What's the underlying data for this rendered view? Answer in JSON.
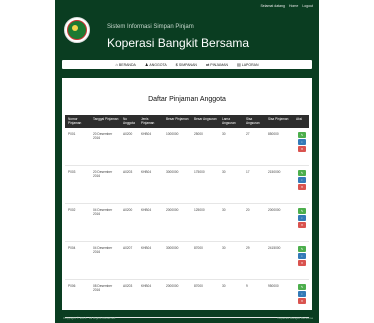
{
  "top_links": [
    "Selamat datang",
    "Home",
    "Logout"
  ],
  "brand": {
    "subtitle": "Sistem Informasi Simpan Pinjam",
    "title": "Koperasi Bangkit Bersama"
  },
  "nav": [
    {
      "icon": "home-icon",
      "glyph": "⌂",
      "label": "BERANDA"
    },
    {
      "icon": "user-icon",
      "glyph": "♟",
      "label": "ANGGOTA"
    },
    {
      "icon": "dollar-icon",
      "glyph": "$",
      "label": "SIMPANAN"
    },
    {
      "icon": "transfer-icon",
      "glyph": "⇄",
      "label": "PINJAMAN"
    },
    {
      "icon": "list-icon",
      "glyph": "▤",
      "label": "LAPORAN"
    }
  ],
  "page_title": "Daftar Pinjaman Anggota",
  "table": {
    "headers": [
      "Nomor Pinjaman",
      "Tanggal Pinjaman",
      "No Anggota",
      "Jenis Pinjaman",
      "Besar Pinjaman",
      "Besar Angsuran",
      "Lama Angsuran",
      "Sisa Angsuran",
      "Sisa Pinjaman",
      "Aksi"
    ],
    "rows": [
      [
        "P001",
        "20 Desember 2016",
        "A0200",
        "KHB04",
        "1000000",
        "25000",
        "30",
        "27",
        "850000"
      ],
      [
        "P003",
        "20 Desember 2016",
        "A0203",
        "KHB04",
        "3000000",
        "175000",
        "30",
        "17",
        "2150000"
      ],
      [
        "P002",
        "04 Desember 2016",
        "A0200",
        "KHB04",
        "2000000",
        "125000",
        "30",
        "20",
        "2000000"
      ],
      [
        "P004",
        "04 Desember 2016",
        "A0207",
        "KHB04",
        "3000000",
        "87000",
        "30",
        "29",
        "2415000"
      ],
      [
        "P006",
        "08 Desember 2016",
        "A0203",
        "KHB04",
        "2000000",
        "87000",
        "30",
        "9",
        "950000"
      ]
    ],
    "action_buttons": [
      {
        "name": "edit-button",
        "color": "#4cae4c",
        "glyph": "✎"
      },
      {
        "name": "view-button",
        "color": "#337ab7",
        "glyph": "i"
      },
      {
        "name": "delete-button",
        "color": "#d9534f",
        "glyph": "✕"
      }
    ]
  },
  "footer": {
    "left": "Copyright © 2016 · All Rights Reserved",
    "right": "Koperasi Bangkit Bersama"
  },
  "colors": {
    "frame_bg": "#0a3d21",
    "header_bg": "#2d2d2d",
    "green": "#4cae4c",
    "blue": "#337ab7",
    "red": "#d9534f"
  }
}
